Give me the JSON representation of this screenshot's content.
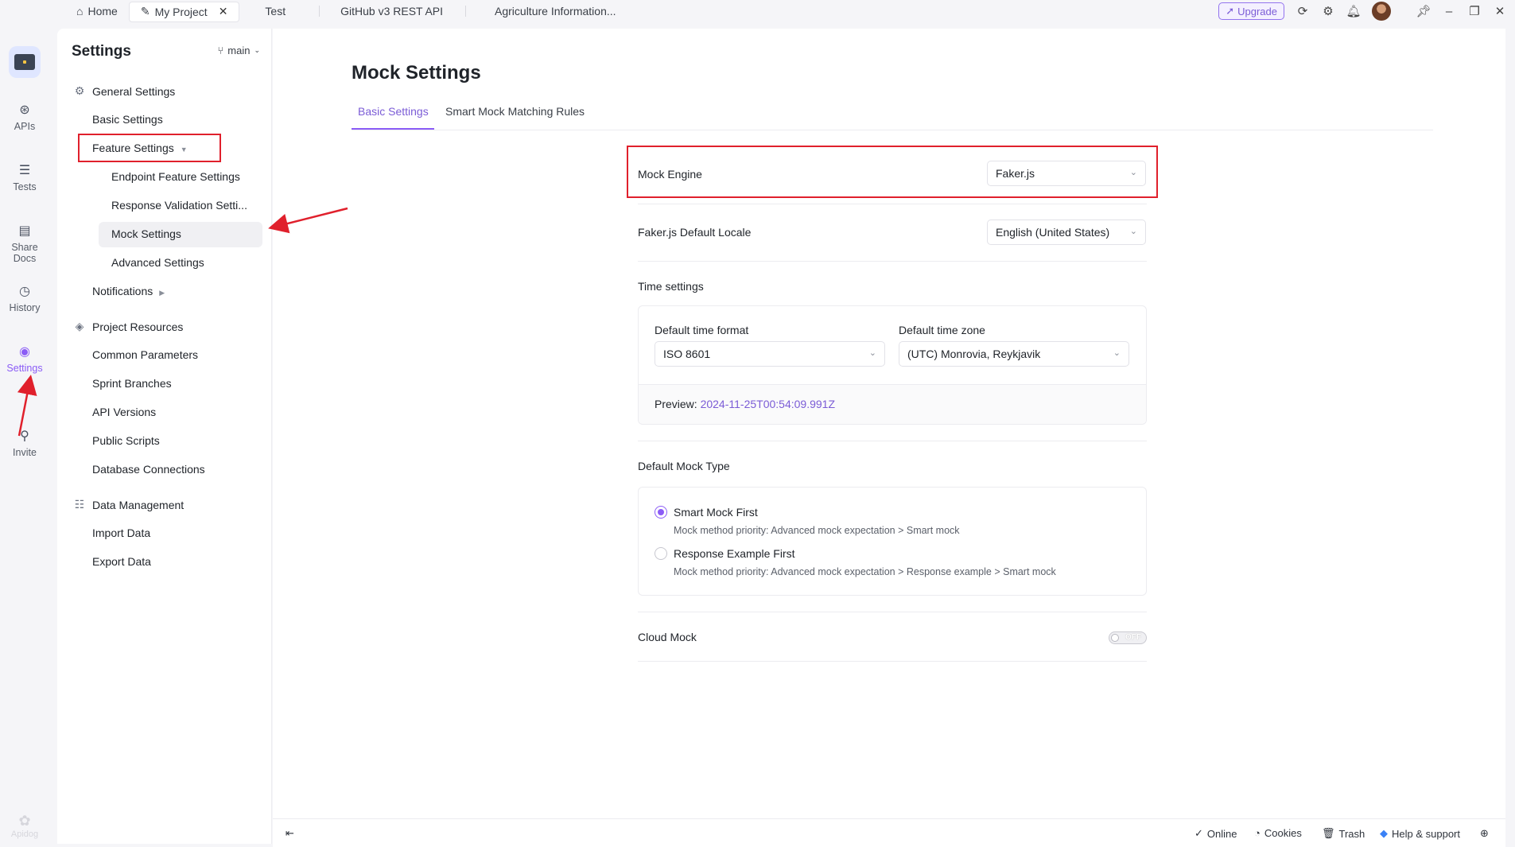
{
  "top_tabs": [
    {
      "label": "Home"
    },
    {
      "label": "My Project"
    },
    {
      "label": "Test"
    },
    {
      "label": "GitHub v3 REST API"
    },
    {
      "label": "Agriculture Information..."
    }
  ],
  "top_right": {
    "upgrade_label": "Upgrade"
  },
  "rail": {
    "items": [
      {
        "label": "APIs"
      },
      {
        "label": "Tests"
      },
      {
        "label": "Share Docs"
      },
      {
        "label": "History"
      },
      {
        "label": "Settings"
      },
      {
        "label": "Invite"
      }
    ],
    "brand": "Apidog"
  },
  "settings_panel": {
    "title": "Settings",
    "branch": "main",
    "general": {
      "label": "General Settings",
      "basic": "Basic Settings",
      "feature": "Feature Settings",
      "feature_children": [
        "Endpoint Feature Settings",
        "Response Validation Setti...",
        "Mock Settings",
        "Advanced Settings"
      ],
      "notifications": "Notifications"
    },
    "resources": {
      "label": "Project Resources",
      "items": [
        "Common Parameters",
        "Sprint Branches",
        "API Versions",
        "Public Scripts",
        "Database Connections"
      ]
    },
    "data": {
      "label": "Data Management",
      "items": [
        "Import Data",
        "Export Data"
      ]
    }
  },
  "main": {
    "title": "Mock Settings",
    "tabs": [
      "Basic Settings",
      "Smart Mock Matching Rules"
    ],
    "mock_engine": {
      "label": "Mock Engine",
      "value": "Faker.js"
    },
    "locale": {
      "label": "Faker.js Default Locale",
      "value": "English (United States)"
    },
    "time": {
      "label": "Time settings",
      "format_label": "Default time format",
      "format_value": "ISO 8601",
      "zone_label": "Default time zone",
      "zone_value": "(UTC) Monrovia, Reykjavik",
      "preview_label": "Preview:",
      "preview_value": "2024-11-25T00:54:09.991Z"
    },
    "mock_type": {
      "label": "Default Mock Type",
      "options": [
        {
          "label": "Smart Mock First",
          "hint": "Mock method priority: Advanced mock expectation > Smart mock",
          "selected": true
        },
        {
          "label": "Response Example First",
          "hint": "Mock method priority: Advanced mock expectation > Response example > Smart mock",
          "selected": false
        }
      ]
    },
    "cloud_mock": {
      "label": "Cloud Mock",
      "state": "OFF"
    }
  },
  "footer": {
    "online": "Online",
    "cookies": "Cookies",
    "trash": "Trash",
    "help": "Help & support"
  },
  "colors": {
    "accent": "#8b5cf6",
    "annotation": "#e0202c"
  }
}
